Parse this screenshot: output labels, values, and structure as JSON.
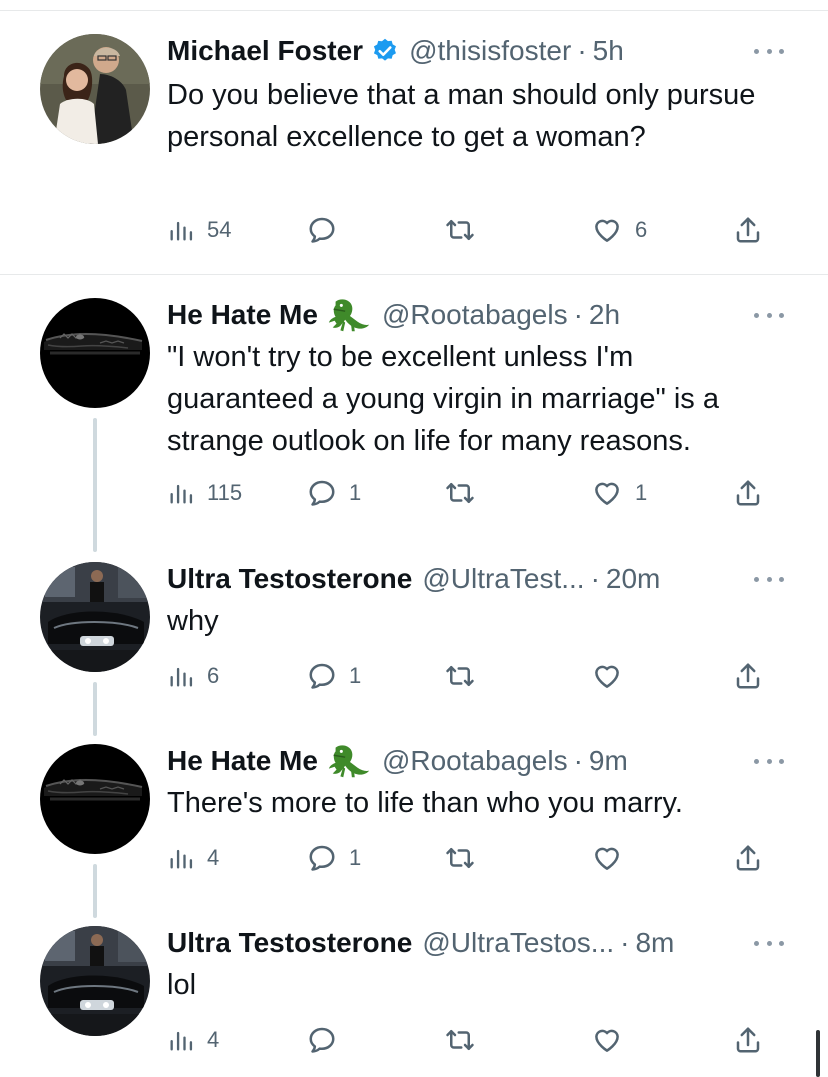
{
  "colors": {
    "verified": "#1d9bf0",
    "secondary_text": "#536471",
    "thread_line": "#cfd9de"
  },
  "tweets": [
    {
      "name": "Michael Foster",
      "verified": true,
      "handle": "@thisisfoster",
      "time": "5h",
      "text": "Do you believe that a man should only pursue personal excellence to get a woman?",
      "views": "54",
      "replies": "",
      "retweets": "",
      "likes": "6"
    },
    {
      "name": "He Hate Me",
      "emoji": "crocodile-icon",
      "handle": "@Rootabagels",
      "time": "2h",
      "text": "\"I won't try to be excellent unless I'm guaranteed a young virgin in marriage\" is a strange outlook on life for many reasons.",
      "views": "115",
      "replies": "1",
      "retweets": "",
      "likes": "1"
    },
    {
      "name": "Ultra Testosterone",
      "handle": "@UltraTest...",
      "time": "20m",
      "text": "why",
      "views": "6",
      "replies": "1",
      "retweets": "",
      "likes": ""
    },
    {
      "name": "He Hate Me",
      "emoji": "crocodile-icon",
      "handle": "@Rootabagels",
      "time": "9m",
      "text": "There's more to life than who you marry.",
      "views": "4",
      "replies": "1",
      "retweets": "",
      "likes": ""
    },
    {
      "name": "Ultra Testosterone",
      "handle": "@UltraTestos...",
      "time": "8m",
      "text": "lol",
      "views": "4",
      "replies": "",
      "retweets": "",
      "likes": ""
    }
  ],
  "separator": "·"
}
